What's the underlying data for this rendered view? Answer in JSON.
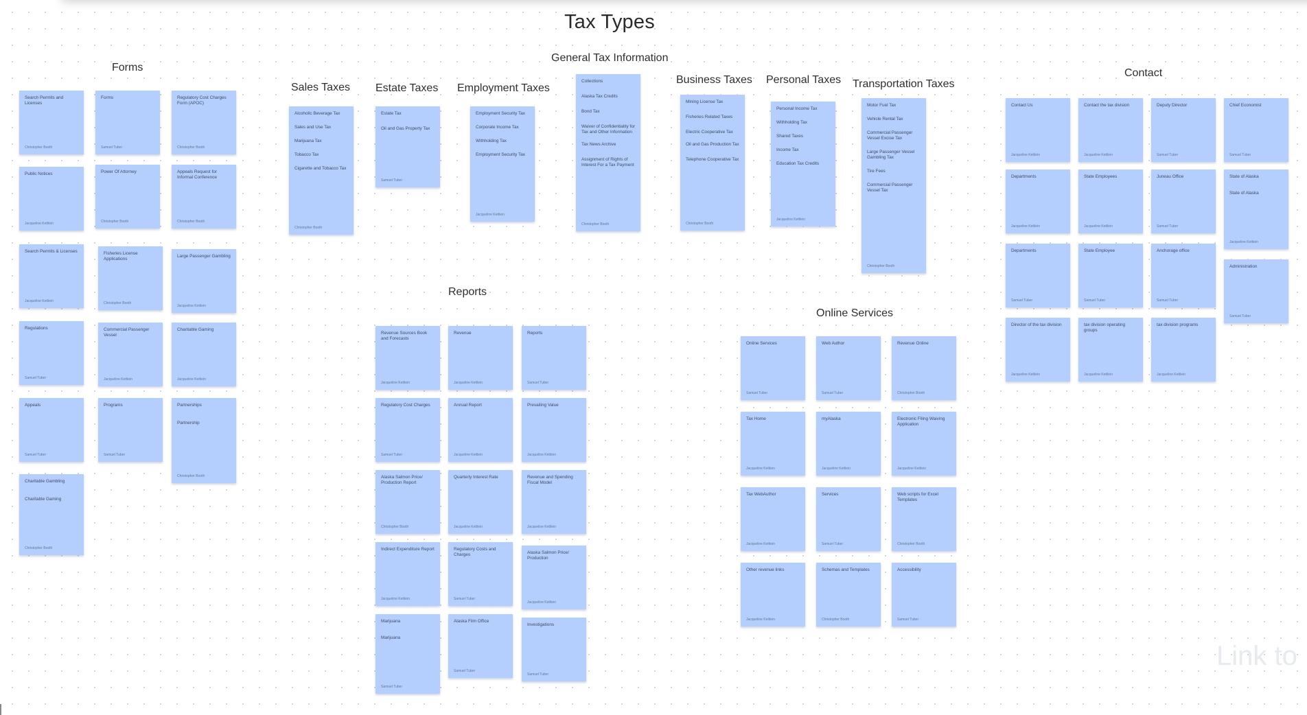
{
  "board": {
    "title": "Tax Types",
    "watermark": "Link to"
  },
  "sections": [
    {
      "label": "Forms"
    },
    {
      "label": "Sales Taxes"
    },
    {
      "label": "Estate Taxes"
    },
    {
      "label": "Employment Taxes"
    },
    {
      "label": "General Tax Information"
    },
    {
      "label": "Business Taxes"
    },
    {
      "label": "Personal Taxes"
    },
    {
      "label": "Transportation Taxes"
    },
    {
      "label": "Contact"
    },
    {
      "label": "Reports"
    },
    {
      "label": "Online Services"
    }
  ],
  "notes": [
    {
      "lines": [
        "Search Permits and Licenses"
      ],
      "author": "Christopher Booth"
    },
    {
      "lines": [
        "Forms"
      ],
      "author": "Samuel Tuber"
    },
    {
      "lines": [
        "Regulatory Cost Charges Form (APOC)"
      ],
      "author": "Christopher Booth"
    },
    {
      "lines": [
        "Public Notices"
      ],
      "author": "Jacqueline Kettlein"
    },
    {
      "lines": [
        "Power Of Attorney"
      ],
      "author": "Christopher Booth"
    },
    {
      "lines": [
        "Appeals Request for Informal Conference"
      ],
      "author": "Christopher Booth"
    },
    {
      "lines": [
        "Search Permits & Licenses"
      ],
      "author": "Jacqueline Kettlein"
    },
    {
      "lines": [
        "Fisheries License Applications"
      ],
      "author": "Christopher Booth"
    },
    {
      "lines": [
        "Large Passenger Gambling"
      ],
      "author": "Jacqueline Kettlein"
    },
    {
      "lines": [
        "Regulations"
      ],
      "author": "Samuel Tuber"
    },
    {
      "lines": [
        "Commercial Passenger Vessel"
      ],
      "author": "Jacqueline Kettlein"
    },
    {
      "lines": [
        "Charitable Gaming"
      ],
      "author": "Jacqueline Kettlein"
    },
    {
      "lines": [
        "Appeals"
      ],
      "author": "Samuel Tuber"
    },
    {
      "lines": [
        "Programs"
      ],
      "author": "Samuel Tuber"
    },
    {
      "lines": [
        "Partnerships",
        "Partnership"
      ],
      "author": "Christopher Booth"
    },
    {
      "lines": [
        "Charitable Gambling",
        "Charitable Gaming"
      ],
      "author": "Christopher Booth"
    },
    {
      "lines": [
        "Alcoholic Beverage Tax",
        "Sales and Use Tax",
        "Marijuana Tax",
        "Tobacco Tax",
        "Cigarette and Tobacco Tax"
      ],
      "author": "Christopher Booth"
    },
    {
      "lines": [
        "Estate Tax",
        "Oil and Gas Property Tax"
      ],
      "author": "Samuel Tuber"
    },
    {
      "lines": [
        "Employment Security Tax",
        "Corporate Income Tax",
        "Withholding Tax",
        "Employment Security Tax"
      ],
      "author": "Jacqueline Kettlein"
    },
    {
      "lines": [
        "Collections",
        "Alaska Tax Credits",
        "Bond Tax",
        "Waiver of Confidentiality for Tax and Other Information",
        "Tax News Archive",
        "Assignment of Rights of Interest For a Tax Payment"
      ],
      "author": "Christopher Booth"
    },
    {
      "lines": [
        "Mining License Tax",
        "Fisheries Related Taxes",
        "Electric Cooperative Tax",
        "Oil and Gas Production Tax",
        "Telephone Cooperative Tax"
      ],
      "author": "Christopher Booth"
    },
    {
      "lines": [
        "Personal Income Tax",
        "Withholding Tax",
        "Shared Taxes",
        "Income Tax",
        "Education Tax Credits"
      ],
      "author": "Jacqueline Kettlein"
    },
    {
      "lines": [
        "Motor Fuel Tax",
        "Vehicle Rental Tax",
        "Commercial Passenger Vessel Excise Tax",
        "Large Passenger Vessel Gambling Tax",
        "Tire Fees",
        "Commercial Passenger Vessel Tax"
      ],
      "author": "Christopher Booth"
    },
    {
      "lines": [
        "Contact Us"
      ],
      "author": "Jacqueline Kettlein"
    },
    {
      "lines": [
        "Contact the tax division"
      ],
      "author": "Jacqueline Kettlein"
    },
    {
      "lines": [
        "Deputy Director"
      ],
      "author": "Samuel Tuber"
    },
    {
      "lines": [
        "Chief Economist"
      ],
      "author": "Samuel Tuber"
    },
    {
      "lines": [
        "Departments"
      ],
      "author": "Jacqueline Kettlein"
    },
    {
      "lines": [
        "State Employees"
      ],
      "author": "Jacqueline Kettlein"
    },
    {
      "lines": [
        "Juneau Office"
      ],
      "author": "Samuel Tuber"
    },
    {
      "lines": [
        "State of Alaska",
        "State of Alaska"
      ],
      "author": "Jacqueline Kettlein"
    },
    {
      "lines": [
        "Departments"
      ],
      "author": "Samuel Tuber"
    },
    {
      "lines": [
        "State Employee"
      ],
      "author": "Samuel Tuber"
    },
    {
      "lines": [
        "Anchorage office"
      ],
      "author": "Samuel Tuber"
    },
    {
      "lines": [
        "Administration"
      ],
      "author": "Samuel Tuber"
    },
    {
      "lines": [
        "Director of the tax division"
      ],
      "author": "Jacqueline Kettlein"
    },
    {
      "lines": [
        "tax division operating groups"
      ],
      "author": "Jacqueline Kettlein"
    },
    {
      "lines": [
        "tax division programs"
      ],
      "author": "Jacqueline Kettlein"
    },
    {
      "lines": [
        "Revenue Sources Book and Forecasts"
      ],
      "author": "Jacqueline Kettlein"
    },
    {
      "lines": [
        "Revenue"
      ],
      "author": "Jacqueline Kettlein"
    },
    {
      "lines": [
        "Reports"
      ],
      "author": "Samuel Tuber"
    },
    {
      "lines": [
        "Regulatory Cost Charges"
      ],
      "author": "Samuel Tuber"
    },
    {
      "lines": [
        "Annual Report"
      ],
      "author": "Jacqueline Kettlein"
    },
    {
      "lines": [
        "Prevailing Value"
      ],
      "author": "Jacqueline Kettlein"
    },
    {
      "lines": [
        "Alaska Salmon Price/ Production Report"
      ],
      "author": "Christopher Booth"
    },
    {
      "lines": [
        "Quarterly Interest Rate"
      ],
      "author": "Jacqueline Kettlein"
    },
    {
      "lines": [
        "Revenue and Spending Fiscal Model"
      ],
      "author": "Jacqueline Kettlein"
    },
    {
      "lines": [
        "Indirect Expenditure Report"
      ],
      "author": "Jacqueline Kettlein"
    },
    {
      "lines": [
        "Regulatory Costs and Charges"
      ],
      "author": "Samuel Tuber"
    },
    {
      "lines": [
        "Alaska Salmon Price/ Production"
      ],
      "author": "Jacqueline Kettlein"
    },
    {
      "lines": [
        "Marijuana",
        "Marijuana"
      ],
      "author": "Samuel Tuber"
    },
    {
      "lines": [
        "Alaska Film Office"
      ],
      "author": "Samuel Tuber"
    },
    {
      "lines": [
        "Investigations"
      ],
      "author": "Samuel Tuber"
    },
    {
      "lines": [
        "Online Services"
      ],
      "author": "Samuel Tuber"
    },
    {
      "lines": [
        "Web Author"
      ],
      "author": "Samuel Tuber"
    },
    {
      "lines": [
        "Revenue Online"
      ],
      "author": "Christopher Booth"
    },
    {
      "lines": [
        "Tax Home"
      ],
      "author": "Jacqueline Kettlein"
    },
    {
      "lines": [
        "myAlaska"
      ],
      "author": "Jacqueline Kettlein"
    },
    {
      "lines": [
        "Electronic Filing Waiving Application"
      ],
      "author": "Jacqueline Kettlein"
    },
    {
      "lines": [
        "Tax WebAuthor"
      ],
      "author": "Jacqueline Kettlein"
    },
    {
      "lines": [
        "Services"
      ],
      "author": "Samuel Tuber"
    },
    {
      "lines": [
        "Web scripts for Excel Templates"
      ],
      "author": "Christopher Booth"
    },
    {
      "lines": [
        "Other revenue links"
      ],
      "author": "Jacqueline Kettlein"
    },
    {
      "lines": [
        "Schemas and Templates"
      ],
      "author": "Christopher Booth"
    },
    {
      "lines": [
        "Accessibility"
      ],
      "author": "Samuel Tuber"
    }
  ],
  "theme": {
    "note_color": "#b4cefd",
    "background": "#ffffff",
    "grid_dot": "#d4d7dc"
  }
}
